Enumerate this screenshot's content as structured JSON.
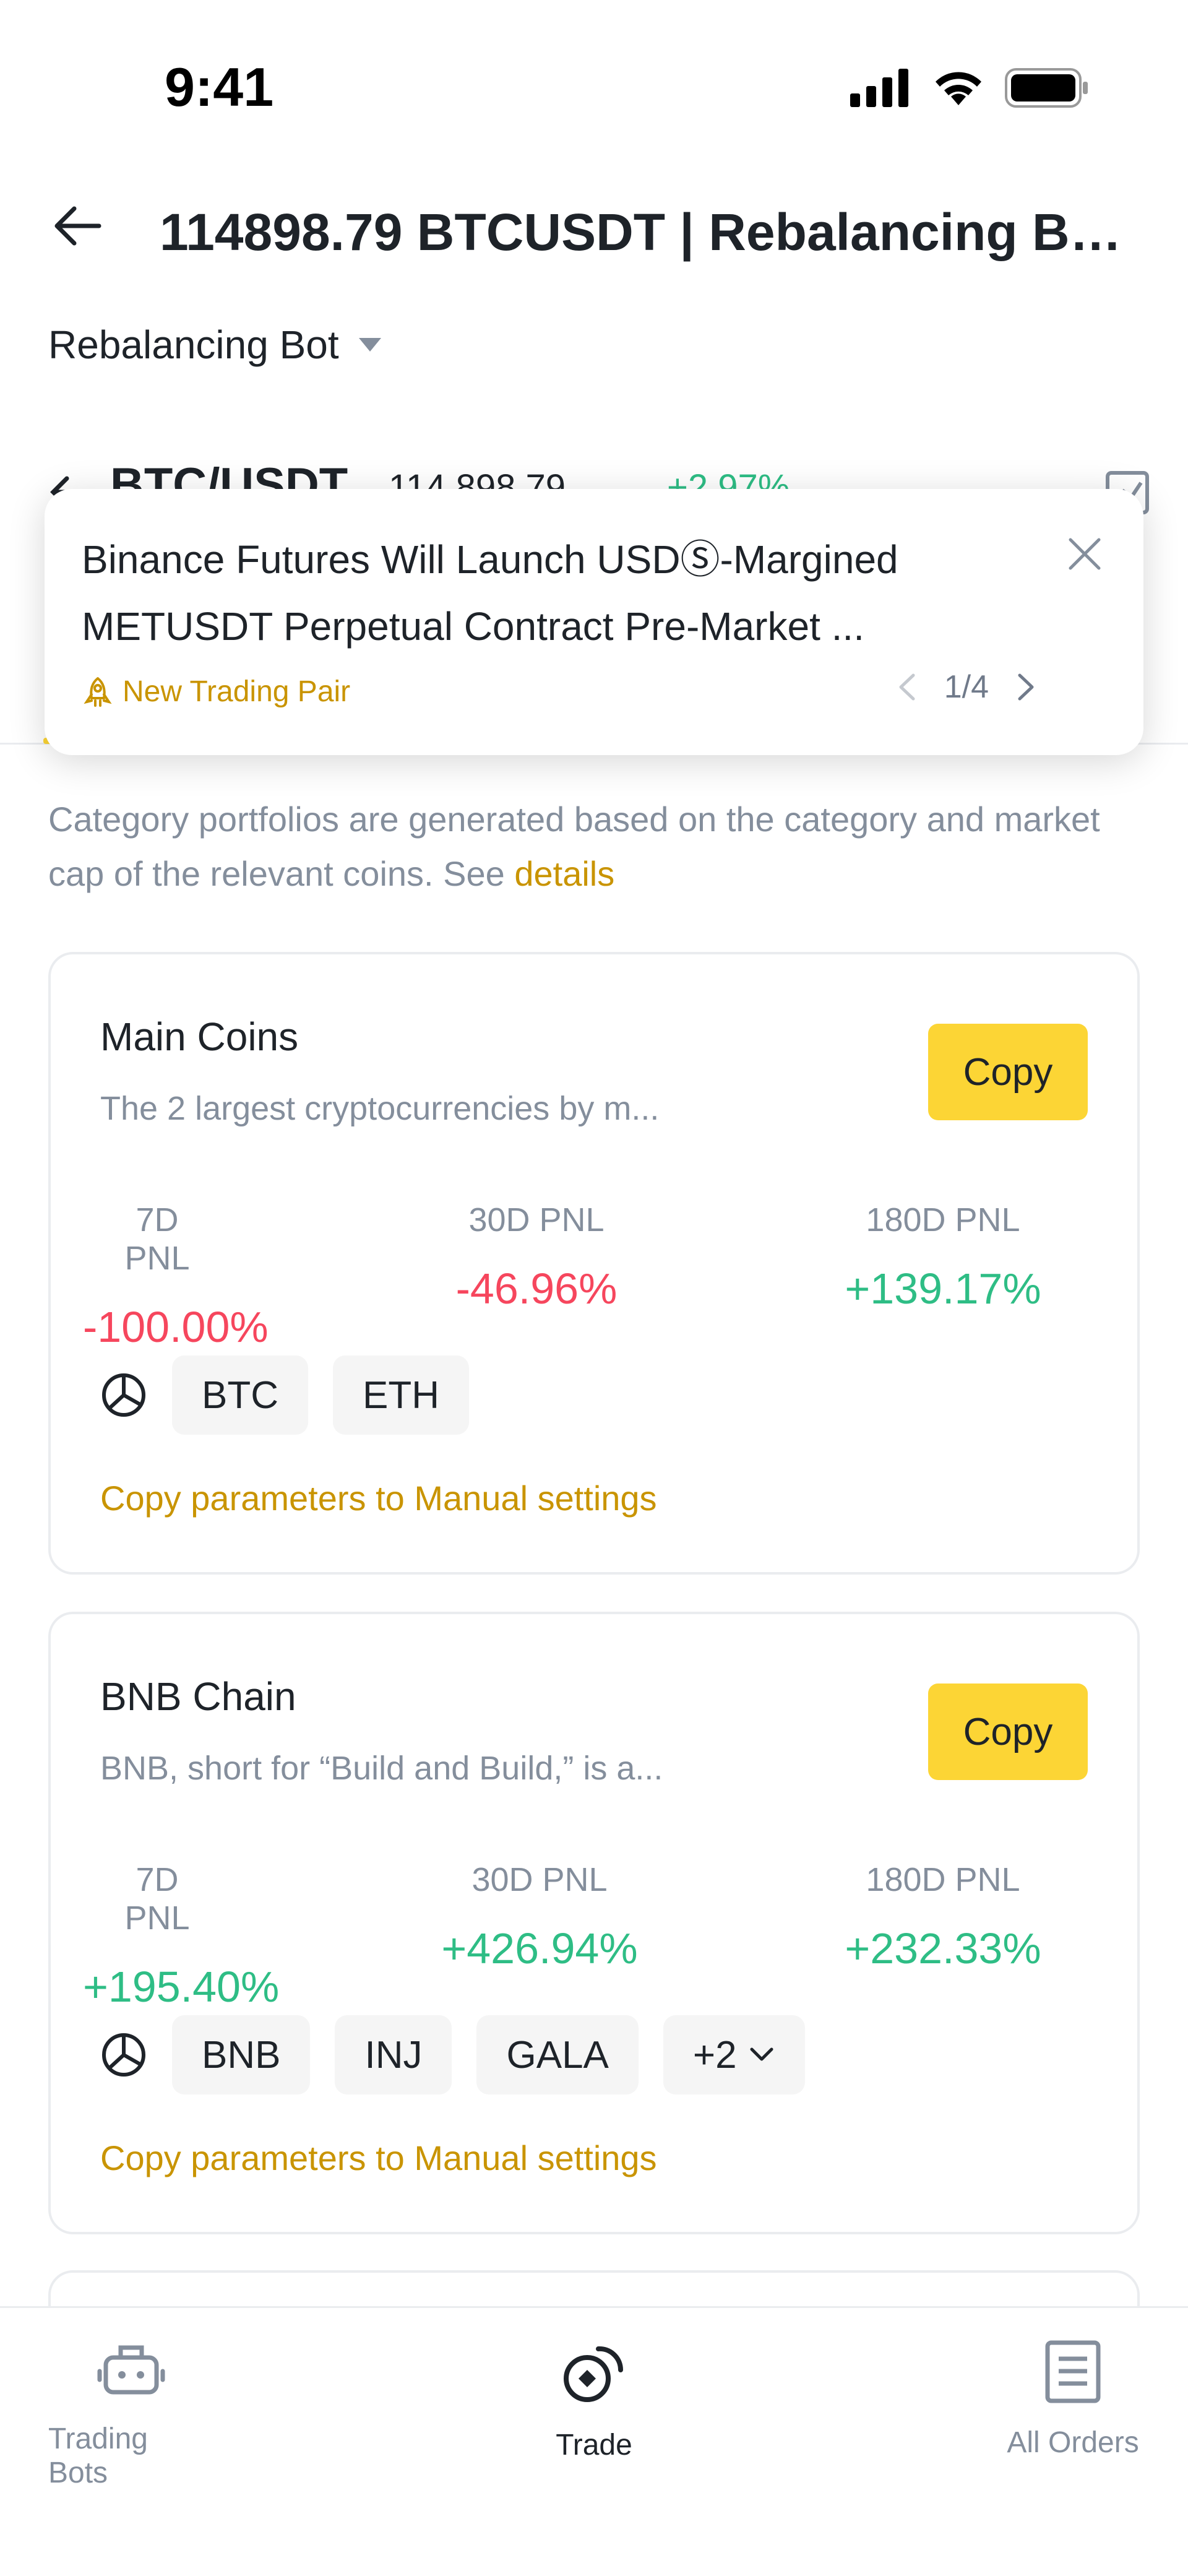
{
  "status_bar": {
    "time": "9:41"
  },
  "header": {
    "title": "114898.79 BTCUSDT | Rebalancing Bot..."
  },
  "bot_selector": {
    "label": "Rebalancing Bot"
  },
  "pair": {
    "name": "BTC/USDT",
    "price": "114,898.79",
    "change": "+2.97%"
  },
  "notice": {
    "text": "Binance Futures Will Launch USDⓈ-Margined METUSDT Perpetual Contract Pre-Market ...",
    "tag": "New Trading Pair",
    "pager": "1/4"
  },
  "description": {
    "text": "Category portfolios are generated based on the category and market cap of the relevant coins. See ",
    "link": "details"
  },
  "cards": [
    {
      "title": "Main Coins",
      "desc": "The 2 largest cryptocurrencies by m...",
      "copy_label": "Copy",
      "pnl": [
        {
          "label": "7D PNL",
          "value": "-100.00%"
        },
        {
          "label": "30D PNL",
          "value": "-46.96%"
        },
        {
          "label": "180D PNL",
          "value": "+139.17%"
        }
      ],
      "coins": [
        "BTC",
        "ETH"
      ],
      "copy_params": "Copy parameters to Manual settings"
    },
    {
      "title": "BNB Chain",
      "desc": "BNB, short for “Build and Build,” is a...",
      "copy_label": "Copy",
      "pnl": [
        {
          "label": "7D PNL",
          "value": "+195.40%"
        },
        {
          "label": "30D PNL",
          "value": "+426.94%"
        },
        {
          "label": "180D PNL",
          "value": "+232.33%"
        }
      ],
      "coins": [
        "BNB",
        "INJ",
        "GALA"
      ],
      "more_coins": "+2",
      "copy_params": "Copy parameters to Manual settings"
    }
  ],
  "bottom_nav": [
    {
      "label": "Trading Bots",
      "icon": "robot-icon"
    },
    {
      "label": "Trade",
      "icon": "trade-icon"
    },
    {
      "label": "All Orders",
      "icon": "orders-icon"
    }
  ],
  "colors": {
    "accent": "#fcd535",
    "link": "#c99400",
    "positive": "#2ebd85",
    "negative": "#f6465d"
  }
}
